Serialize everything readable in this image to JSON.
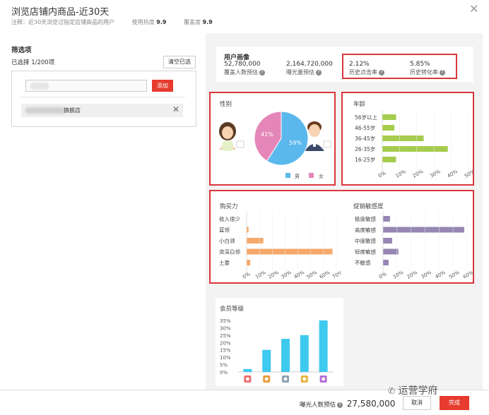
{
  "dialog": {
    "title": "浏览店铺内商品-近30天",
    "note_prefix": "注释：近30天浏览过指定店铺商品的用户",
    "relevance_label": "使用热度",
    "relevance_value": "9.9",
    "coverage_label": "覆盖度",
    "coverage_value": "9.9"
  },
  "filter": {
    "title": "筛选项",
    "selected": "已选择 1/200项",
    "clear_button": "清空已选",
    "add_button": "添加",
    "shop_suffix": "旗舰店"
  },
  "profile": {
    "title": "用户画像",
    "stats": [
      {
        "value": "52,780,000",
        "label": "覆盖人数预估"
      },
      {
        "value": "2,164,720,000",
        "label": "曝光量预估"
      },
      {
        "value": "2.12%",
        "label": "历史点击率"
      },
      {
        "value": "5.85%",
        "label": "历史转化率"
      }
    ]
  },
  "gender": {
    "title": "性别",
    "legend_male": "男",
    "legend_female": "女",
    "male_color": "#5bb8ec",
    "female_color": "#e487b8"
  },
  "charts": {
    "gender": {
      "type": "pie",
      "slices": [
        {
          "name": "男",
          "value": 59
        },
        {
          "name": "女",
          "value": 41
        }
      ],
      "labels": [
        "59%",
        "41%"
      ]
    },
    "age": {
      "type": "bar",
      "title": "年龄",
      "categories": [
        "56岁以上",
        "46-55岁",
        "36-45岁",
        "26-35岁",
        "16-25岁"
      ],
      "values": [
        8,
        7,
        24,
        38,
        8
      ],
      "xticks": [
        "0%",
        "10%",
        "20%",
        "30%",
        "40%",
        "50%"
      ],
      "xmax": 50,
      "color": "#a6cc4e"
    },
    "income": {
      "type": "bar",
      "title": "购买力",
      "categories": [
        "收入很少",
        "蓝领",
        "小白领",
        "资深白领",
        "土豪"
      ],
      "values": [
        0,
        1.5,
        13,
        67,
        2.8
      ],
      "xticks": [
        "0%",
        "10%",
        "20%",
        "30%",
        "40%",
        "50%",
        "60%",
        "70%"
      ],
      "xmax": 70,
      "color": "#f5a96a"
    },
    "promo": {
      "type": "bar",
      "title": "促销敏感度",
      "categories": [
        "极度敏感",
        "高度敏感",
        "中度敏感",
        "轻度敏感",
        "不敏感"
      ],
      "values": [
        5,
        58,
        6.5,
        11,
        4
      ],
      "xticks": [
        "0%",
        "10%",
        "20%",
        "30%",
        "40%",
        "50%",
        "60%"
      ],
      "xmax": 60,
      "color": "#9686b3"
    },
    "member": {
      "type": "bar",
      "title": "会员等级",
      "categories": [
        "V1",
        "V2",
        "V3",
        "V4",
        "V5"
      ],
      "values": [
        2,
        15,
        22.5,
        25,
        35
      ],
      "yticks": [
        "35%",
        "30%",
        "25%",
        "20%",
        "15%",
        "10%",
        "5%",
        "0%"
      ],
      "ymax": 35,
      "color": "#3ec9ef"
    }
  },
  "footer": {
    "estimate_label": "曝光人数预估",
    "estimate_value": "27,580,000",
    "cancel": "取消",
    "done": "完成",
    "watermark": "运营学府"
  }
}
